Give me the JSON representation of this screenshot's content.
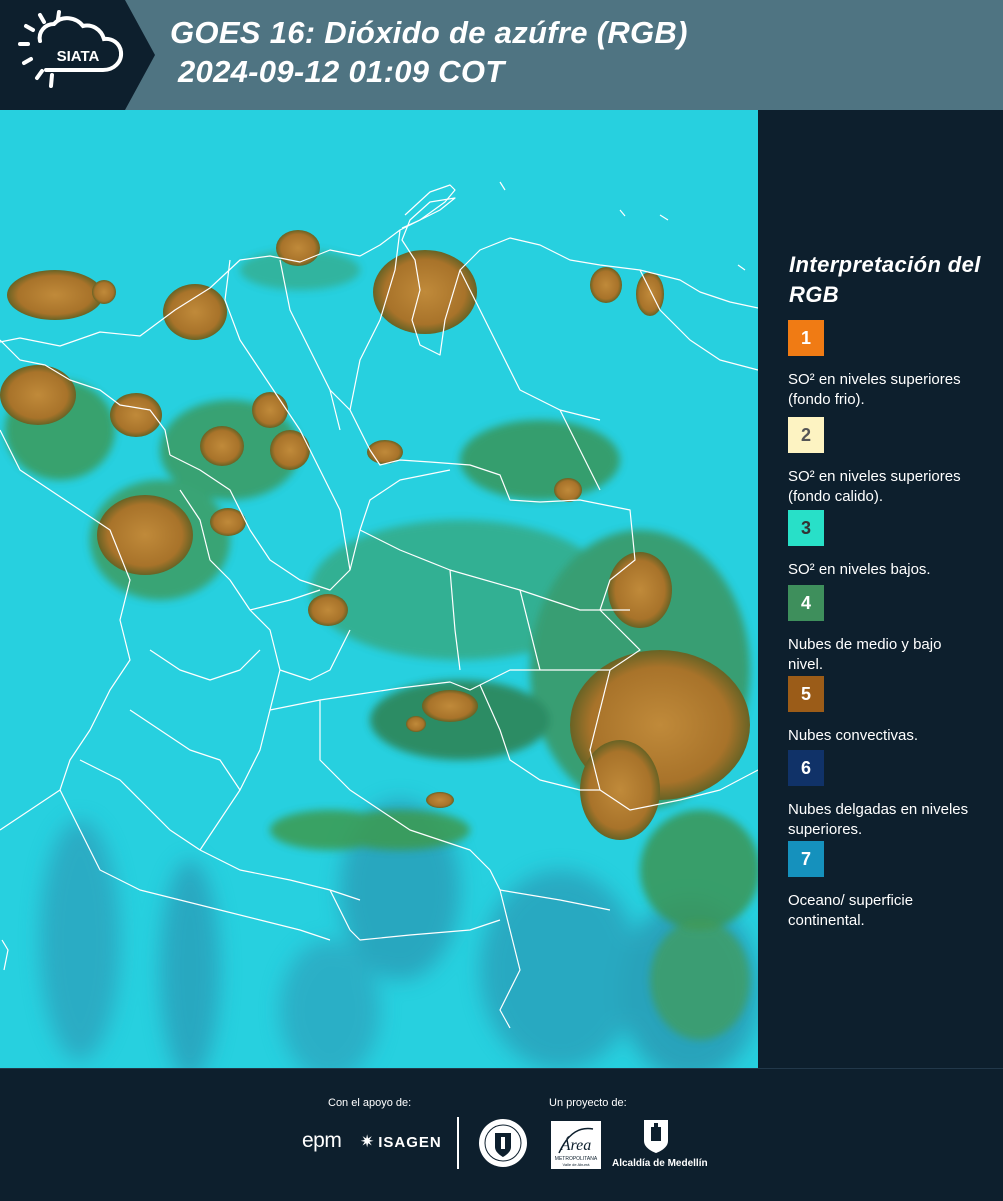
{
  "header": {
    "logo_text": "SIATA",
    "title_line1": "GOES 16: Dióxido de azúfre (RGB)",
    "title_line2": "2024-09-12 01:09 COT"
  },
  "legend": {
    "title": "Interpretación del RGB",
    "items": [
      {
        "number": "1",
        "color": "#f07b14",
        "text_color": "#ffffff",
        "description": "SO² en niveles superiores (fondo frio)."
      },
      {
        "number": "2",
        "color": "#fdf3c2",
        "text_color": "#555555",
        "description": "SO² en niveles superiores (fondo calido)."
      },
      {
        "number": "3",
        "color": "#28e0c8",
        "text_color": "#333333",
        "description": "SO² en niveles bajos."
      },
      {
        "number": "4",
        "color": "#3e8f5c",
        "text_color": "#ffffff",
        "description": "Nubes de medio y bajo nivel."
      },
      {
        "number": "5",
        "color": "#9b5c18",
        "text_color": "#ffffff",
        "description": "Nubes convectivas."
      },
      {
        "number": "6",
        "color": "#103268",
        "text_color": "#ffffff",
        "description": "Nubes delgadas en niveles superiores."
      },
      {
        "number": "7",
        "color": "#1591bd",
        "text_color": "#ffffff",
        "description": "Oceano/ superficie continental."
      }
    ]
  },
  "footer": {
    "support_label": "Con el apoyo de:",
    "project_label": "Un proyecto de:",
    "epm": "epm",
    "isagen": "ISAGEN",
    "area_metropolitana": "Área",
    "area_sub": "METROPOLITANA",
    "area_sub2": "Valle de Aburrá",
    "alcaldia": "Alcaldía de Medellín"
  }
}
